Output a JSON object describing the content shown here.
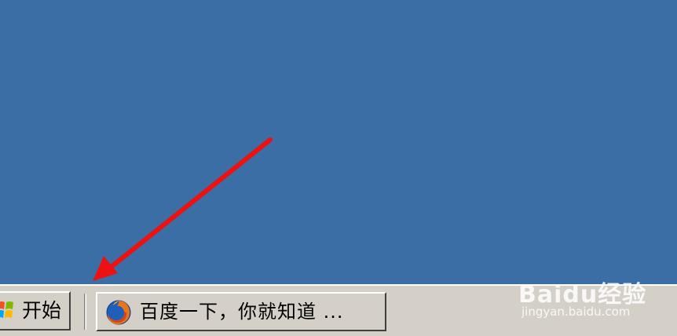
{
  "desktop": {
    "background_color": "#3a6ea5"
  },
  "taskbar": {
    "start_button": {
      "label": "开始",
      "icon": "windows-logo-icon"
    },
    "tasks": [
      {
        "label": "百度一下，你就知道 ...",
        "icon": "firefox-icon"
      }
    ]
  },
  "annotation": {
    "arrow_color": "#ee1111"
  },
  "watermark": {
    "brand": "Baidu经验",
    "url": "jingyan.baidu.com"
  }
}
